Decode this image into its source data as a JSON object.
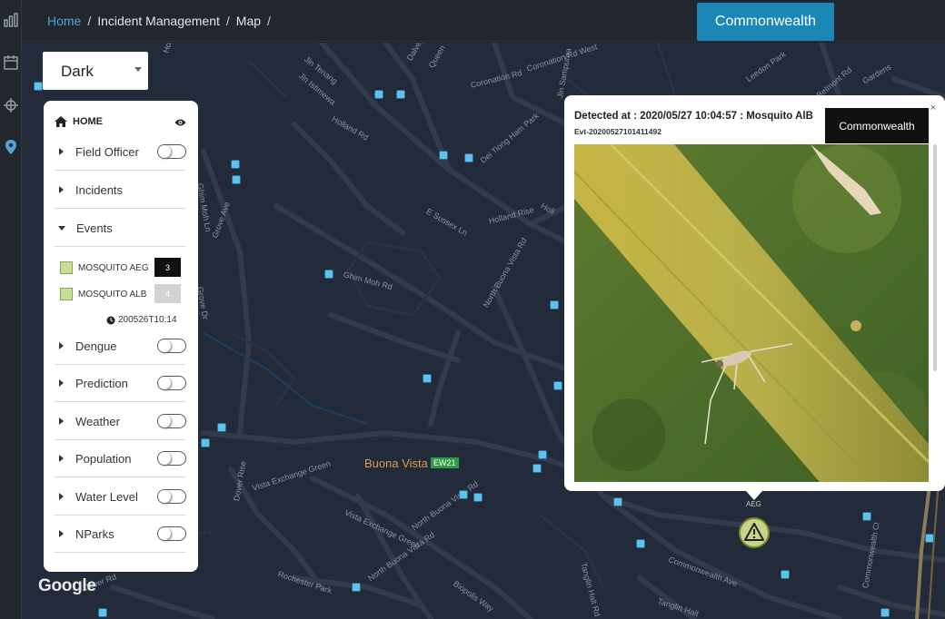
{
  "breadcrumb": {
    "home": "Home",
    "sep": "/",
    "section": "Incident Management",
    "page": "Map"
  },
  "top_button": "Commonwealth",
  "rail_icons": [
    "bar-chart-icon",
    "calendar-icon",
    "crosshair-icon",
    "map-pin-icon"
  ],
  "map_style_select": {
    "value": "Dark"
  },
  "layer_panel": {
    "home_label": "HOME",
    "items": [
      {
        "label": "Field Officer",
        "toggle": true
      },
      {
        "label": "Incidents",
        "toggle": false
      },
      {
        "label": "Events",
        "toggle": false,
        "expanded": true
      },
      {
        "label": "Dengue",
        "toggle": true
      },
      {
        "label": "Prediction",
        "toggle": true
      },
      {
        "label": "Weather",
        "toggle": true
      },
      {
        "label": "Population",
        "toggle": true
      },
      {
        "label": "Water Level",
        "toggle": true
      },
      {
        "label": "NParks",
        "toggle": true
      }
    ],
    "events": [
      {
        "label": "MOSQUITO AEG",
        "count": "3",
        "count_color": "#111111"
      },
      {
        "label": "MOSQUITO ALB",
        "count": "4",
        "count_color": "#d3d3d3"
      }
    ],
    "timestamp": "200526T10:14"
  },
  "map_labels": {
    "streets": [
      "Jln Tenang",
      "Jln Istimewa",
      "Holland Gr",
      "Coronation Rd West",
      "Leedon Park",
      "Belmont Rd",
      "Gardens",
      "Jln Sampurna",
      "Dalvey Park",
      "Queen",
      "Coronation Rd",
      "Dei Tiong Ham Park",
      "Holland Rd",
      "E Sussex Ln",
      "Holland Rise",
      "Holl",
      "Ghim Moh Rd",
      "North Buona Vista Rd",
      "Grove Ave",
      "Grove Dr",
      "Ghim Moh Ln",
      "Vista Exchange Green",
      "Dover Rise",
      "Rochester Park",
      "Biopolis Way",
      "Commonwealth Ave",
      "Tanglin Halt Rd",
      "Tanglin Halt",
      "Commonwealth Cl",
      "Dover Rd"
    ],
    "station": "Buona Vista",
    "station_code": "EW21",
    "google": "Google",
    "marker_label": "AEG"
  },
  "popup": {
    "detected": "Detected at : 2020/05/27 10:04:57 : Mosquito AlB",
    "event_id": "Evt-20200527101411492",
    "tooltip": "Commonwealth",
    "close": "×"
  },
  "colors": {
    "accent": "#1b87b6",
    "map_bg": "#232a39",
    "event_swatch": "#c6df98",
    "station": "#2e9c45"
  }
}
